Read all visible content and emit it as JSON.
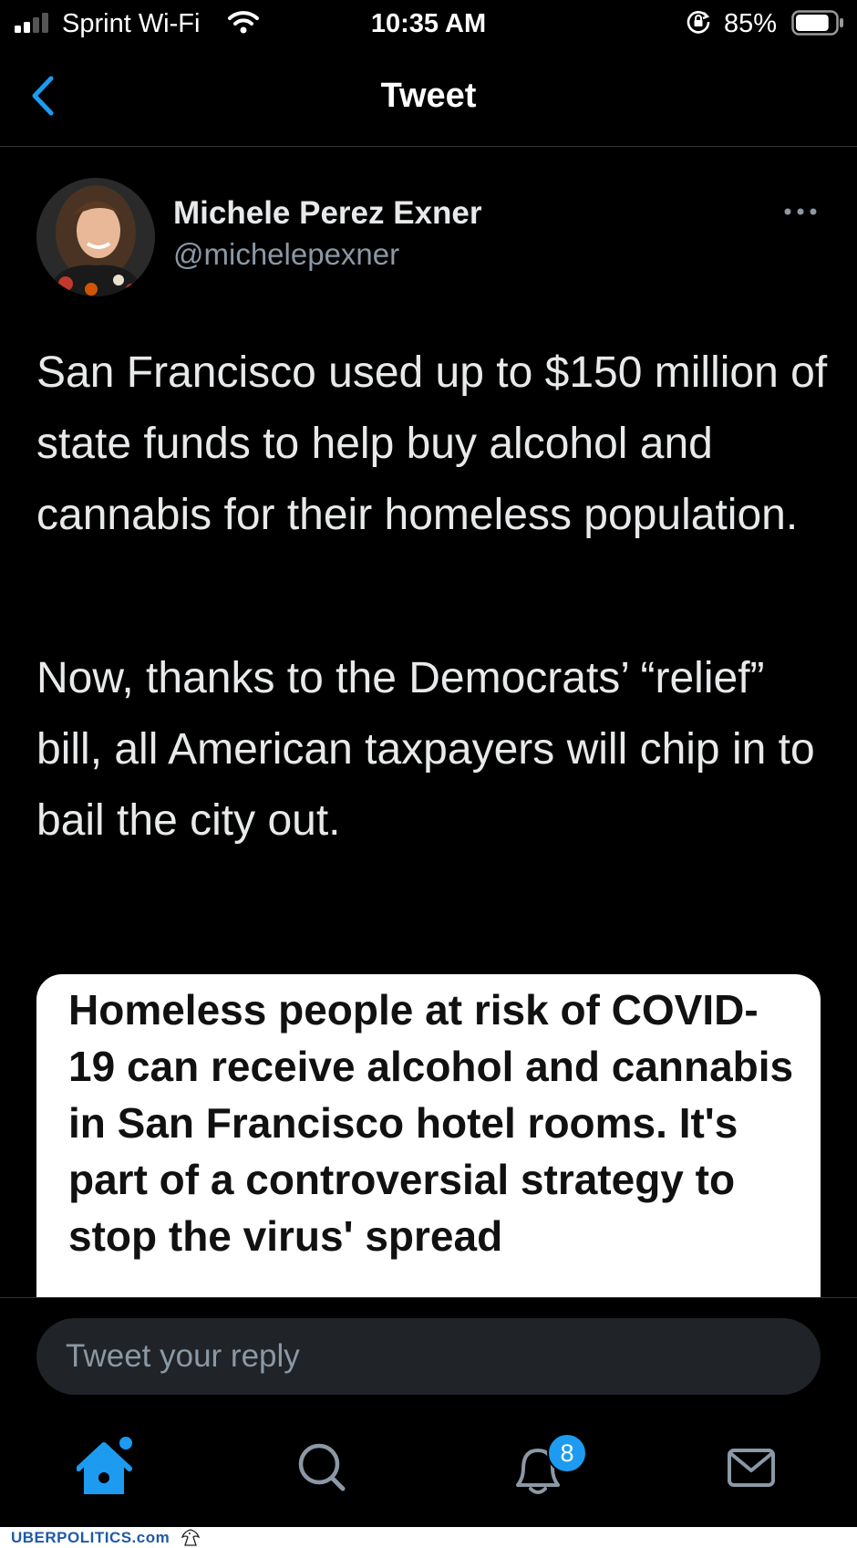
{
  "status_bar": {
    "carrier": "Sprint Wi-Fi",
    "time": "10:35 AM",
    "battery_percent": "85%",
    "battery_level": 0.85
  },
  "nav": {
    "title": "Tweet",
    "back_icon": "chevron-left-icon"
  },
  "tweet": {
    "author_name": "Michele Perez Exner",
    "author_handle": "@michelepexner",
    "more_icon": "more-horizontal-icon",
    "paragraphs": [
      "San Francisco used up to $150 million of state funds to help buy alcohol and cannabis for their homeless population.",
      "Now, thanks to the Democrats’ “relief” bill, all American taxpayers will chip in to bail the city out."
    ],
    "card_headline": "Homeless people at risk of COVID-19 can receive alcohol and cannabis in San Francisco hotel rooms. It's part of a controversial strategy to stop the virus' spread"
  },
  "reply": {
    "placeholder": "Tweet your reply"
  },
  "tabbar": {
    "items": [
      "home-icon",
      "search-icon",
      "notifications-icon",
      "messages-icon"
    ],
    "notifications_badge": "8"
  },
  "watermark": {
    "text": "UBERPOLITICS.com"
  },
  "colors": {
    "accent": "#1d9bf0",
    "background": "#000000",
    "secondary_text": "#8b98a5"
  }
}
